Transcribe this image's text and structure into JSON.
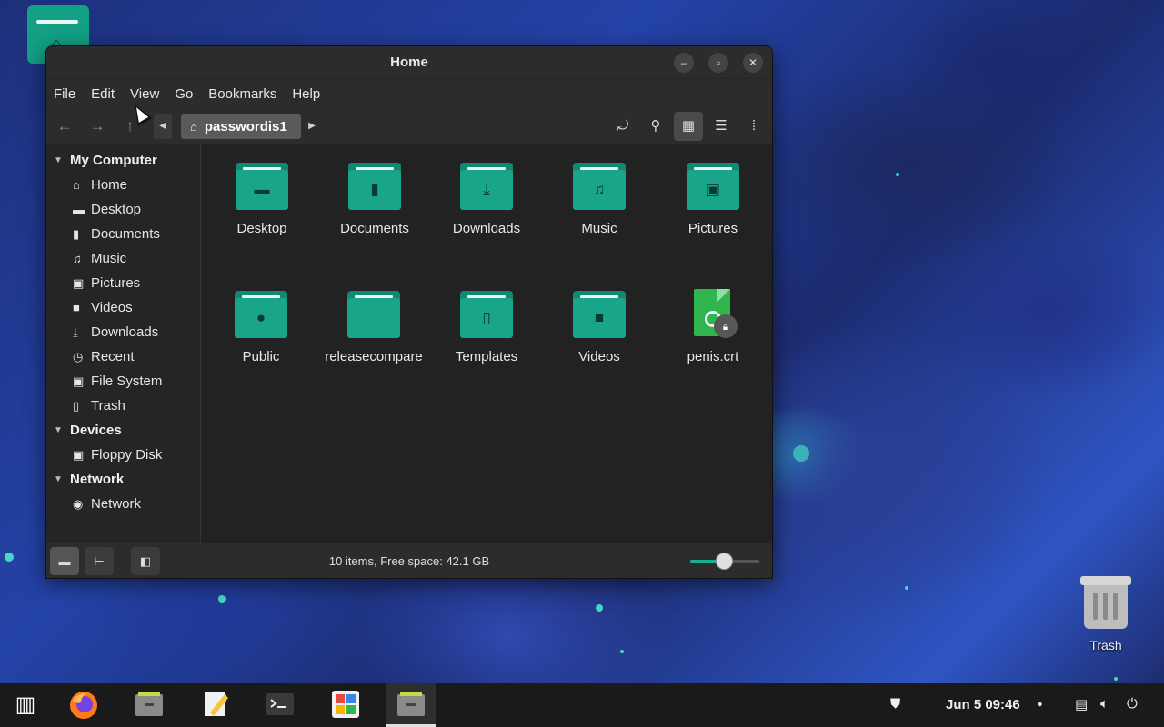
{
  "window": {
    "title": "Home",
    "minimize_icon": "minimize-icon",
    "maximize_icon": "maximize-icon",
    "close_icon": "close-icon"
  },
  "menubar": [
    "File",
    "Edit",
    "View",
    "Go",
    "Bookmarks",
    "Help"
  ],
  "toolbar": {
    "path_label": "passwordis1",
    "buttons": [
      "back-icon",
      "forward-icon",
      "up-icon",
      "toggle-location-icon",
      "search-icon",
      "icon-view-icon",
      "list-view-icon",
      "compact-view-icon"
    ]
  },
  "sidebar": {
    "sections": [
      {
        "label": "My Computer",
        "items": [
          {
            "label": "Home",
            "icon": "home-icon"
          },
          {
            "label": "Desktop",
            "icon": "desktop-icon"
          },
          {
            "label": "Documents",
            "icon": "document-icon"
          },
          {
            "label": "Music",
            "icon": "music-icon"
          },
          {
            "label": "Pictures",
            "icon": "picture-icon"
          },
          {
            "label": "Videos",
            "icon": "video-icon"
          },
          {
            "label": "Downloads",
            "icon": "download-icon"
          },
          {
            "label": "Recent",
            "icon": "clock-icon"
          },
          {
            "label": "File System",
            "icon": "drive-icon"
          },
          {
            "label": "Trash",
            "icon": "trash-icon"
          }
        ]
      },
      {
        "label": "Devices",
        "items": [
          {
            "label": "Floppy Disk",
            "icon": "floppy-icon"
          }
        ]
      },
      {
        "label": "Network",
        "items": [
          {
            "label": "Network",
            "icon": "globe-icon"
          }
        ]
      }
    ]
  },
  "files": [
    {
      "name": "Desktop",
      "icon": "desktop-folder-icon"
    },
    {
      "name": "Documents",
      "icon": "documents-folder-icon"
    },
    {
      "name": "Downloads",
      "icon": "downloads-folder-icon"
    },
    {
      "name": "Music",
      "icon": "music-folder-icon"
    },
    {
      "name": "Pictures",
      "icon": "pictures-folder-icon"
    },
    {
      "name": "Public",
      "icon": "public-folder-icon"
    },
    {
      "name": "releasecompare",
      "icon": "folder-icon"
    },
    {
      "name": "Templates",
      "icon": "templates-folder-icon"
    },
    {
      "name": "Videos",
      "icon": "videos-folder-icon"
    },
    {
      "name": "penis.crt",
      "icon": "certificate-file-icon"
    }
  ],
  "statusbar": {
    "text": "10 items, Free space: 42.1 GB",
    "zoom_level": 0.5
  },
  "desktop": {
    "trash_label": "Trash"
  },
  "taskbar": {
    "clock": "Jun 5  09:46",
    "apps": [
      "menu-icon",
      "firefox-icon",
      "file-manager-icon",
      "text-editor-icon",
      "terminal-icon",
      "software-manager-icon",
      "file-manager-active-icon"
    ],
    "tray": [
      "shield-icon",
      "notification-dot-icon",
      "network-icon",
      "volume-icon",
      "power-icon"
    ]
  },
  "colors": {
    "accent": "#18a58a",
    "window_bg": "#222222",
    "taskbar_bg": "#1a1a1a"
  }
}
